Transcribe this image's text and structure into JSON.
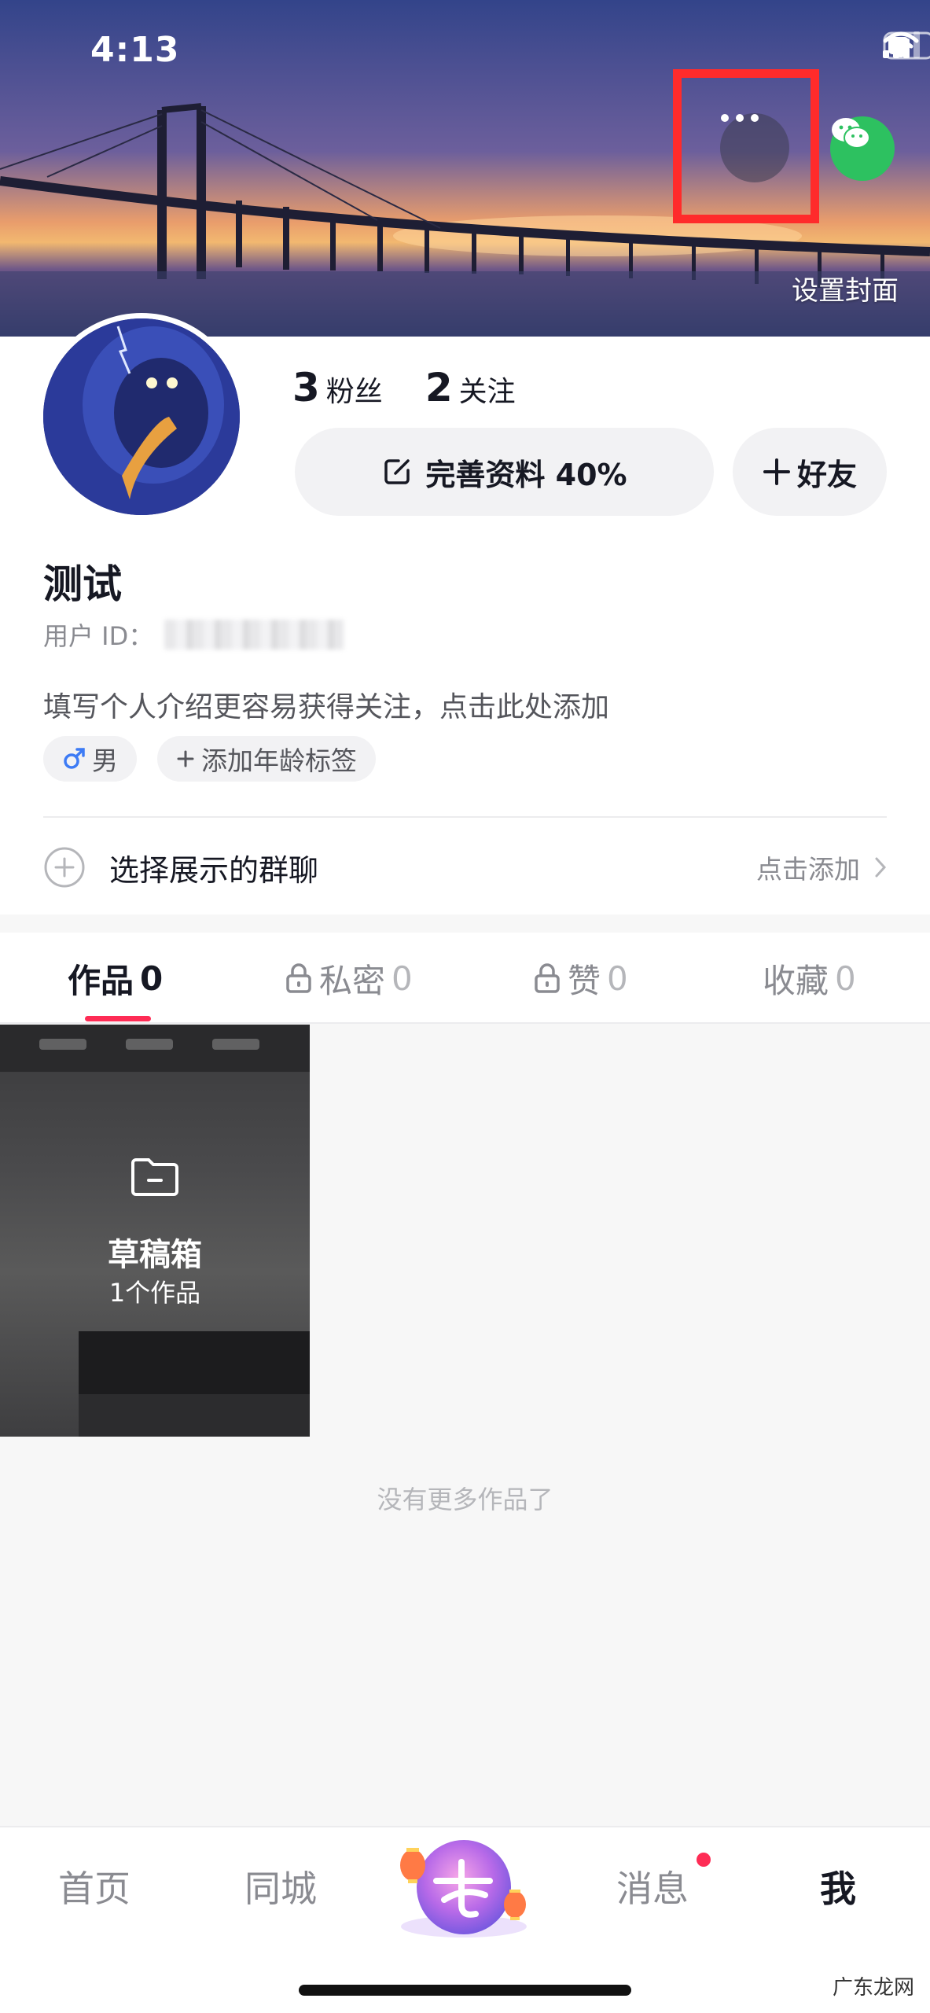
{
  "status_bar": {
    "time": "4:13"
  },
  "cover": {
    "set_cover_label": "设置封面"
  },
  "stats": {
    "followers_count": "3",
    "followers_label": "粉丝",
    "following_count": "2",
    "following_label": "关注"
  },
  "actions": {
    "edit_profile_label": "完善资料 40%",
    "add_friend_label": "好友"
  },
  "profile": {
    "name": "测试",
    "user_id_label": "用户 ID：",
    "bio_placeholder": "填写个人介绍更容易获得关注，点击此处添加",
    "gender_label": "男",
    "age_tag_label": "添加年龄标签"
  },
  "group_chat": {
    "title": "选择展示的群聊",
    "action_label": "点击添加"
  },
  "tabs": [
    {
      "label": "作品",
      "count": "0"
    },
    {
      "label": "私密",
      "count": "0"
    },
    {
      "label": "赞",
      "count": "0"
    },
    {
      "label": "收藏",
      "count": "0"
    }
  ],
  "draft": {
    "title": "草稿箱",
    "count_label": "1个作品"
  },
  "no_more_label": "没有更多作品了",
  "bottom_nav": {
    "home": "首页",
    "nearby": "同城",
    "messages": "消息",
    "me": "我"
  },
  "colors": {
    "accent": "#fe2c55",
    "highlight": "#ff2b2b",
    "wechat": "#2dc160"
  },
  "watermark": "广东龙网"
}
